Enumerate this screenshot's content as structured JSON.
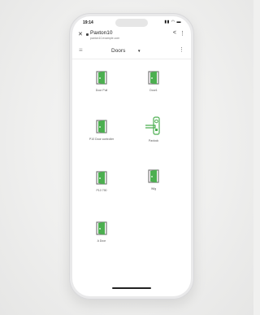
{
  "status": {
    "time": "19:14",
    "icons": "▮▮ ◠ ▬"
  },
  "browser": {
    "title": "Paxton10",
    "url": "paxton10.example.com"
  },
  "toolbar": {
    "dropdown_label": "Doors"
  },
  "doors": [
    {
      "label": "Door Pull",
      "type": "door"
    },
    {
      "label": "Door1",
      "type": "door"
    },
    {
      "label": "P10 Door controller",
      "type": "door"
    },
    {
      "label": "Paxlock",
      "type": "lock"
    },
    {
      "label": "P10 790",
      "type": "door"
    },
    {
      "label": "Wlg",
      "type": "door"
    },
    {
      "label": "A Door",
      "type": "door"
    }
  ],
  "colors": {
    "accent": "#4caf50",
    "accent_dark": "#2e7d32",
    "frame": "#7a7a7a"
  }
}
